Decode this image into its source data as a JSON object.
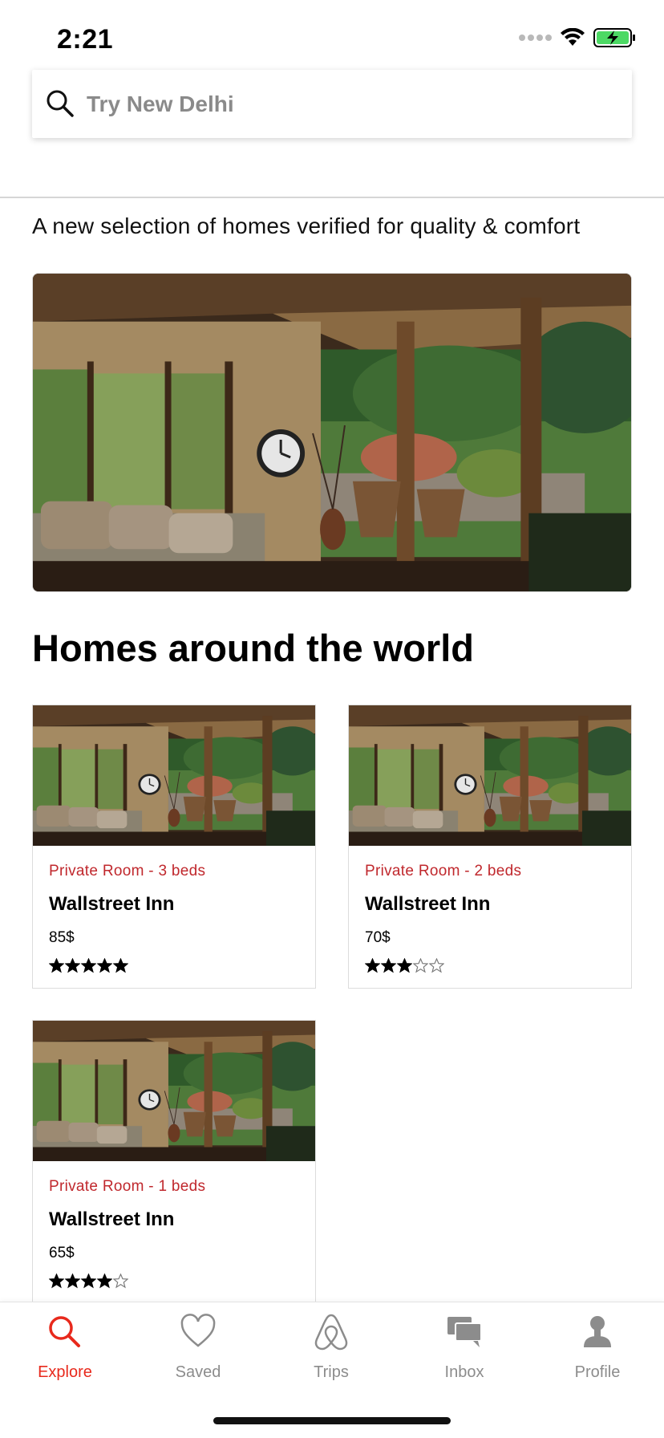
{
  "status": {
    "time": "2:21"
  },
  "search": {
    "placeholder": "Try New Delhi",
    "value": ""
  },
  "intro": {
    "subtitle": "A new selection of homes verified for quality & comfort"
  },
  "section": {
    "title": "Homes around the world"
  },
  "listings": [
    {
      "type": "Private Room - 3 beds",
      "name": "Wallstreet Inn",
      "price": "85$",
      "rating": 5
    },
    {
      "type": "Private Room - 2 beds",
      "name": "Wallstreet Inn",
      "price": "70$",
      "rating": 3
    },
    {
      "type": "Private Room - 1 beds",
      "name": "Wallstreet Inn",
      "price": "65$",
      "rating": 4
    }
  ],
  "tabs": [
    {
      "label": "Explore",
      "icon": "search-icon",
      "active": true
    },
    {
      "label": "Saved",
      "icon": "heart-icon",
      "active": false
    },
    {
      "label": "Trips",
      "icon": "airbnb-logo-icon",
      "active": false
    },
    {
      "label": "Inbox",
      "icon": "chat-bubbles-icon",
      "active": false
    },
    {
      "label": "Profile",
      "icon": "person-icon",
      "active": false
    }
  ],
  "colors": {
    "accent": "#e8291c",
    "listing_type": "#c0282d",
    "tab_inactive": "#8c8c8c"
  }
}
